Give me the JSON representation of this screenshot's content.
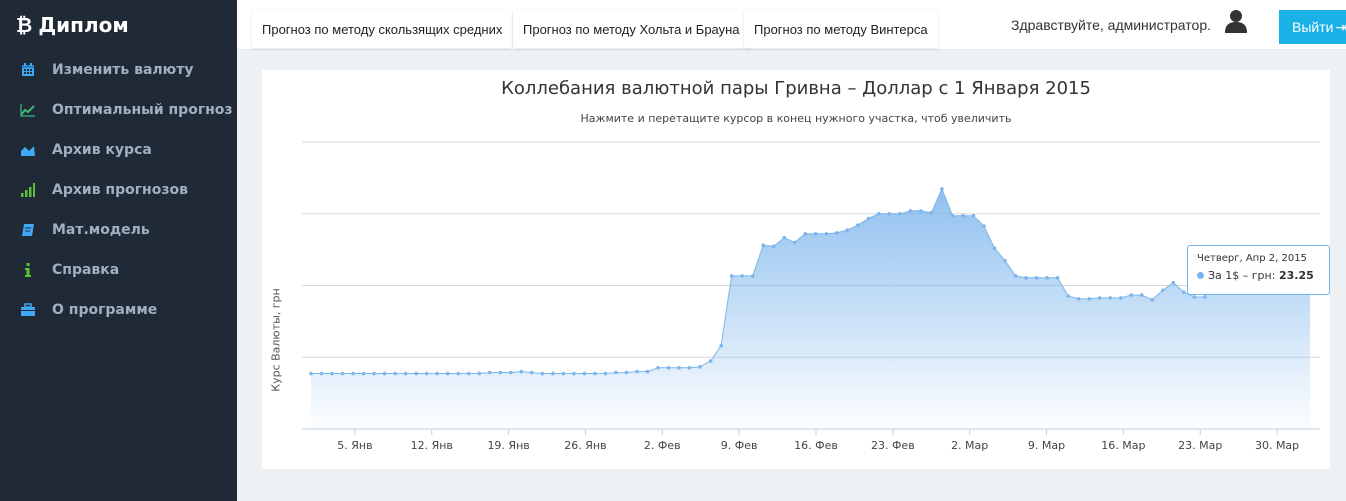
{
  "brand": {
    "title": "Диплом",
    "icon": "bitcoin-icon"
  },
  "sidebar": {
    "items": [
      {
        "label": "Изменить валюту",
        "icon": "calendar-icon",
        "color": "#3fa9f5"
      },
      {
        "label": "Оптимальный прогноз",
        "icon": "line-chart-icon",
        "color": "#3cb878"
      },
      {
        "label": "Архив курса",
        "icon": "area-chart-icon",
        "color": "#3fa9f5"
      },
      {
        "label": "Архив прогнозов",
        "icon": "signal-bars-icon",
        "color": "#5bc236"
      },
      {
        "label": "Мат.модель",
        "icon": "book-icon",
        "color": "#3fa9f5"
      },
      {
        "label": "Справка",
        "icon": "info-icon",
        "color": "#5bc236"
      },
      {
        "label": "О программе",
        "icon": "briefcase-icon",
        "color": "#3fa9f5"
      }
    ]
  },
  "header": {
    "tabs": [
      {
        "label": "Прогноз по методу скользящих средних"
      },
      {
        "label": "Прогноз по методу Хольта и Брауна"
      },
      {
        "label": "Прогноз по методу Винтерса"
      }
    ],
    "greeting": "Здравствуйте, администратор.",
    "logout_label": "Выйти"
  },
  "colors": {
    "sidebar_bg": "#1f2a36",
    "accent": "#1ab1e6",
    "series": "#7cb5ec"
  },
  "tooltip": {
    "date": "Четверг, Апр 2, 2015",
    "series_label": "За 1$ – грн:",
    "value": "23.25"
  },
  "chart_data": {
    "type": "area",
    "title": "Коллебания валютной пары Гривна – Доллар с 1 Января 2015",
    "subtitle": "Нажмите и перетащите курсор в конец нужного участка, чтоб увеличить",
    "xlabel": "",
    "ylabel": "Курс Валюты, грн",
    "x_ticks": [
      "5. Янв",
      "12. Янв",
      "19. Янв",
      "26. Янв",
      "2. Фев",
      "9. Фев",
      "16. Фев",
      "23. Фев",
      "2. Мар",
      "9. Мар",
      "16. Мар",
      "23. Мар",
      "30. Мар"
    ],
    "x_start": "2015-01-01",
    "x_end": "2015-04-02",
    "grid": true,
    "legend": "none",
    "ylim": [
      10,
      40
    ],
    "series": [
      {
        "values": [
          15.8,
          15.8,
          15.8,
          15.8,
          15.8,
          15.8,
          15.8,
          15.8,
          15.8,
          15.8,
          15.8,
          15.8,
          15.8,
          15.8,
          15.8,
          15.8,
          15.8,
          15.9,
          15.9,
          15.9,
          16.0,
          15.9,
          15.8,
          15.8,
          15.8,
          15.8,
          15.8,
          15.8,
          15.8,
          15.9,
          15.9,
          16.0,
          16.0,
          16.4,
          16.4,
          16.4,
          16.4,
          16.5,
          17.1,
          18.7,
          26.0,
          26.0,
          26.0,
          29.2,
          29.1,
          30.0,
          29.5,
          30.4,
          30.4,
          30.4,
          30.5,
          30.8,
          31.3,
          32.0,
          32.5,
          32.5,
          32.5,
          32.8,
          32.8,
          32.6,
          35.1,
          32.3,
          32.3,
          32.3,
          31.2,
          28.9,
          27.6,
          26.0,
          25.8,
          25.8,
          25.8,
          25.8,
          23.9,
          23.6,
          23.6,
          23.7,
          23.7,
          23.7,
          24.0,
          24.0,
          23.5,
          24.5,
          25.3,
          24.3,
          23.8,
          23.8,
          26.2,
          26.6,
          26.5,
          26.5,
          26.5,
          26.5,
          26.5,
          26.6,
          26.5,
          26.2
        ]
      }
    ]
  }
}
